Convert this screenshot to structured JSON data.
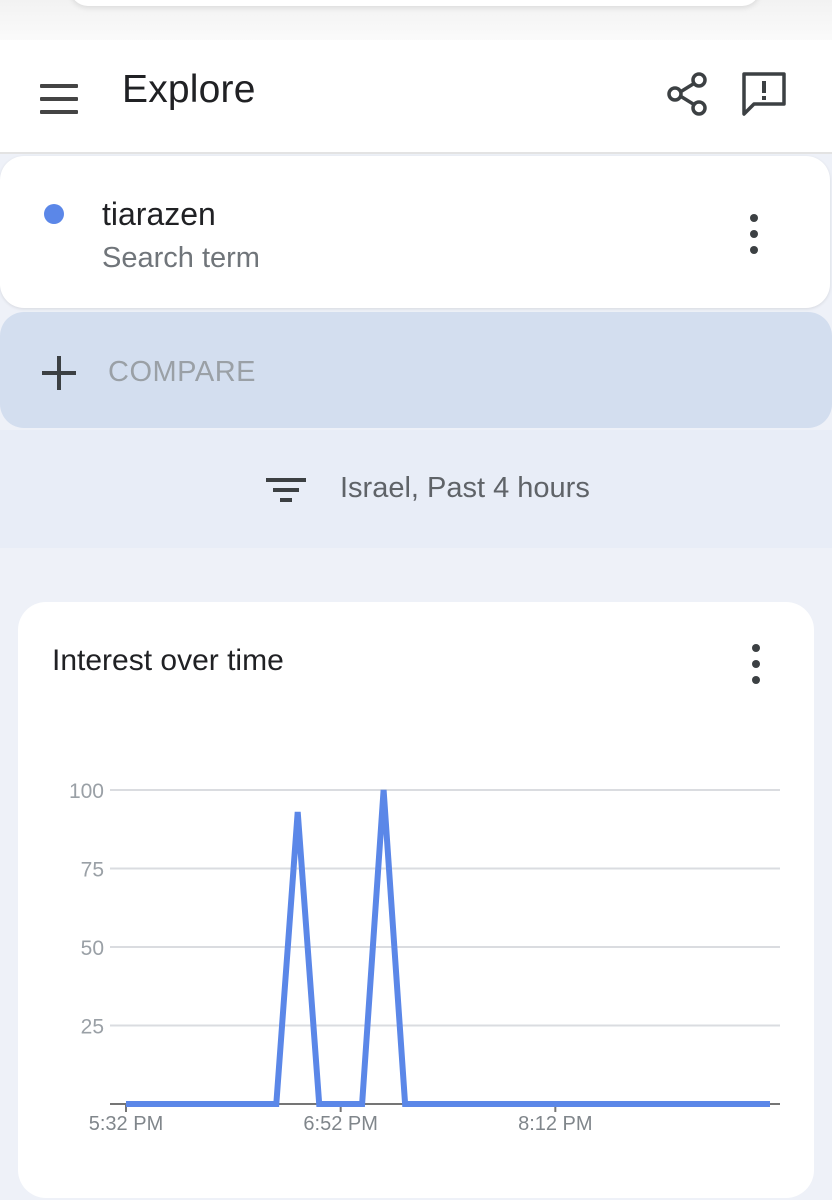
{
  "header": {
    "title": "Explore",
    "menu_icon": "menu-icon",
    "share_icon": "share-icon",
    "feedback_icon": "feedback-icon"
  },
  "term": {
    "name": "tiarazen",
    "type": "Search term",
    "color": "#5b87e8"
  },
  "compare": {
    "label": "COMPARE"
  },
  "filter": {
    "label": "Israel, Past 4 hours"
  },
  "chart_data": {
    "type": "line",
    "title": "Interest over time",
    "xlabel": "",
    "ylabel": "",
    "ylim": [
      0,
      100
    ],
    "yticks": [
      25,
      50,
      75,
      100
    ],
    "xtick_labels": [
      "5:32 PM",
      "6:52 PM",
      "8:12 PM"
    ],
    "xtick_index": [
      0,
      10,
      20
    ],
    "grid": true,
    "color": "#5b87e8",
    "values": [
      0,
      0,
      0,
      0,
      0,
      0,
      0,
      0,
      93,
      0,
      0,
      0,
      100,
      0,
      0,
      0,
      0,
      0,
      0,
      0,
      0,
      0,
      0,
      0,
      0,
      0,
      0,
      0,
      0,
      0,
      0
    ]
  }
}
